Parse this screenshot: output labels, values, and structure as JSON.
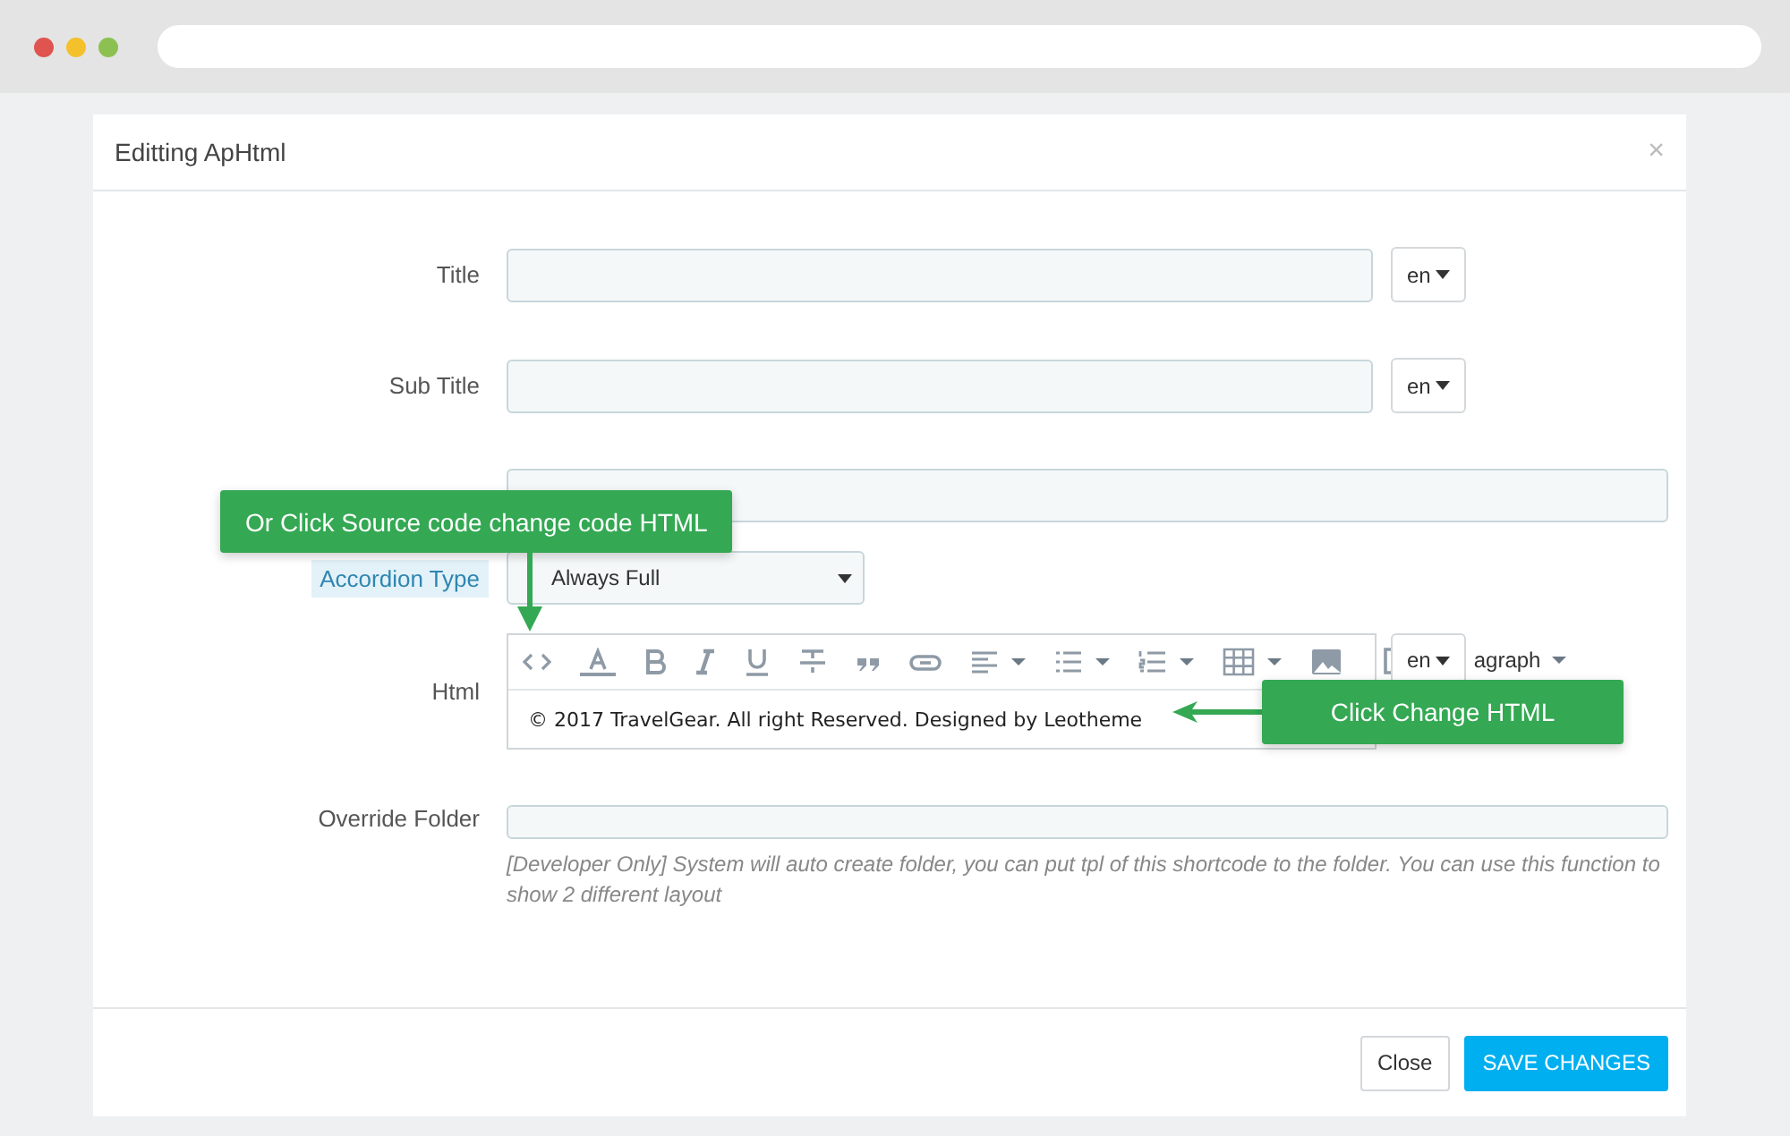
{
  "modal": {
    "title": "Editting ApHtml",
    "close": "×"
  },
  "fields": [
    {
      "kind": "text-lang",
      "label": "Title",
      "lang": "en",
      "highlighted": false
    },
    {
      "kind": "text-lang",
      "label": "Sub Title",
      "lang": "en",
      "highlighted": false
    },
    {
      "kind": "text"
    },
    {
      "kind": "select",
      "label": "Accordion Type",
      "value": "Always Full",
      "highlighted": true
    },
    {
      "kind": "editor",
      "label": "Html",
      "content": "© 2017 TravelGear. All right Reserved. Designed by Leotheme",
      "lang": "en",
      "format": "agraph",
      "highlighted": false
    },
    {
      "kind": "text-help",
      "label": "Override Folder",
      "help": "[Developer Only] System will auto create folder, you can put tpl of this shortcode to the folder. You can use this function to show 2 different layout",
      "highlighted": false
    }
  ],
  "callouts": [
    {
      "kind": "down",
      "text": "Or Click Source code change code HTML"
    },
    {
      "kind": "left",
      "text": "Click Change HTML"
    }
  ],
  "buttons": [
    {
      "kind": "default",
      "label": "Close"
    },
    {
      "kind": "primary",
      "label": "SAVE CHANGES"
    }
  ]
}
